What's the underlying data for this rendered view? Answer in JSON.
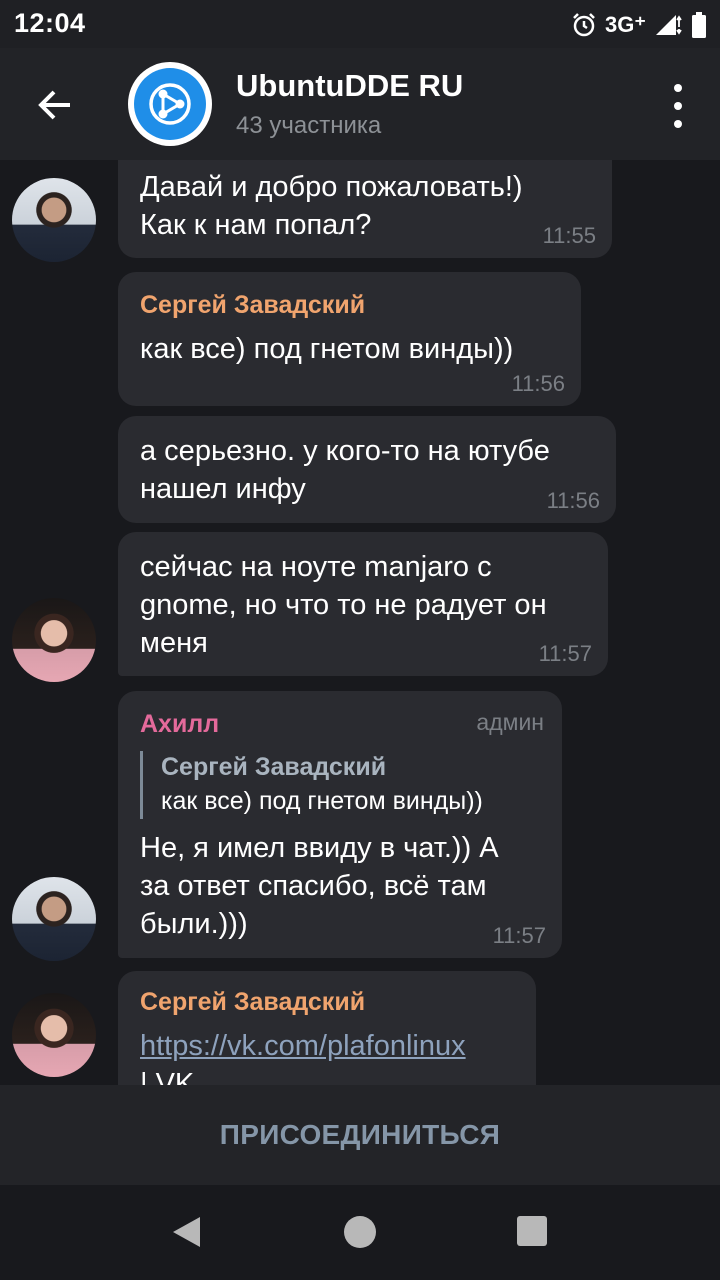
{
  "status_bar": {
    "time": "12:04",
    "network": "3G⁺"
  },
  "header": {
    "title": "UbuntuDDE RU",
    "subtitle": "43 участника"
  },
  "messages": [
    {
      "text": "Давай и добро пожаловать!)\nКак к нам попал?",
      "time": "11:55"
    },
    {
      "sender": "Сергей Завадский",
      "text": "как все) под гнетом винды))",
      "time": "11:56"
    },
    {
      "text": "а серьезно. у кого-то на ютубе\nнашел инфу",
      "time": "11:56"
    },
    {
      "text": "сейчас на ноуте manjaro с\ngnome, но что то не радует он\nменя",
      "time": "11:57"
    },
    {
      "sender": "Ахилл",
      "badge": "админ",
      "reply": {
        "name": "Сергей Завадский",
        "text": "как все) под гнетом винды))"
      },
      "text": "Не, я имел ввиду в чат.)) А\nза ответ спасибо, всё там\nбыли.)))",
      "time": "11:57"
    },
    {
      "sender": "Сергей Завадский",
      "link": "https://vk.com/plafonlinux",
      "text_partial": "| VK"
    }
  ],
  "join_label": "ПРИСОЕДИНИТЬСЯ",
  "colors": {
    "background": "#18191d",
    "bubble": "#2a2b30",
    "sender_orange": "#f0a46e",
    "sender_pink": "#e46a9b",
    "channel_avatar": "#1f8ee8",
    "join_text": "#8596a8"
  },
  "icons": {
    "back": "arrow-left-icon",
    "menu": "more-vertical-icon",
    "channel_logo": "share-network-icon",
    "alarm": "alarm-clock-icon",
    "signal": "signal-icon",
    "battery": "battery-icon"
  }
}
